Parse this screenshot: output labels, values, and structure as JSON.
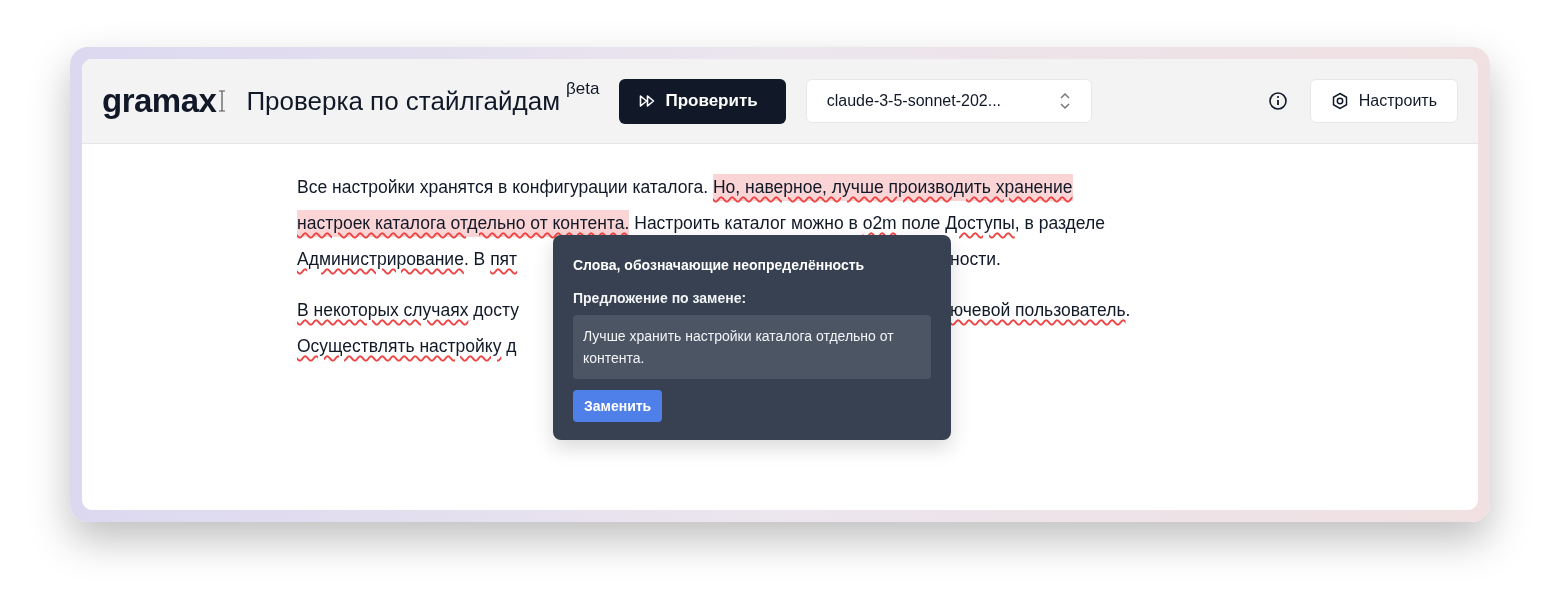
{
  "header": {
    "logo": "gramax",
    "title": "Проверка по стайлгайдам",
    "badge": "βeta",
    "check_button": "Проверить",
    "model_select": {
      "value": "claude-3-5-sonnet-202..."
    },
    "settings_button": "Настроить"
  },
  "document": {
    "paragraphs": [
      {
        "lines": [
          {
            "segments": [
              {
                "text": "Все настройки хранятся в конфигурации каталога. ",
                "highlighted": false,
                "flagged": false
              },
              {
                "text": "Но, наверное, лучше производить хранение",
                "highlighted": true,
                "flagged": true
              }
            ]
          },
          {
            "segments": [
              {
                "text": "настроек каталога отдельно от контента.",
                "highlighted": true,
                "flagged": true
              },
              {
                "text": " Настроить каталог можно в ",
                "highlighted": false,
                "flagged": false
              },
              {
                "text": "o2m",
                "highlighted": false,
                "flagged": true
              },
              {
                "text": " поле ",
                "highlighted": false,
                "flagged": false
              },
              {
                "text": "Доступы",
                "highlighted": false,
                "flagged": true
              },
              {
                "text": ", в разделе",
                "highlighted": false,
                "flagged": false
              }
            ]
          },
          {
            "segments": [
              {
                "text": "Администрирование",
                "highlighted": false,
                "flagged": true
              },
              {
                "text": ". В ",
                "highlighted": false,
                "flagged": false
              },
              {
                "text": "пят",
                "highlighted": false,
                "flagged": true
              }
            ],
            "after_gap": [
              {
                "text": "ности.",
                "highlighted": false,
                "flagged": false
              }
            ]
          }
        ]
      },
      {
        "lines": [
          {
            "segments": [
              {
                "text": "В некоторых случаях",
                "highlighted": false,
                "flagged": true
              },
              {
                "text": " досту",
                "highlighted": false,
                "flagged": false
              }
            ],
            "after_gap": [
              {
                "text": "ючевой пользователь",
                "highlighted": false,
                "flagged": true
              },
              {
                "text": ".",
                "highlighted": false,
                "flagged": false
              }
            ]
          },
          {
            "segments": [
              {
                "text": "Осуществлять настройку",
                "highlighted": false,
                "flagged": true
              },
              {
                "text": " д",
                "highlighted": false,
                "flagged": false
              }
            ]
          }
        ]
      }
    ]
  },
  "tooltip": {
    "title": "Слова, обозначающие неопределённость",
    "label": "Предложение по замене:",
    "suggestion": "Лучше хранить настройки каталога отдельно от контента.",
    "replace_button": "Заменить"
  }
}
